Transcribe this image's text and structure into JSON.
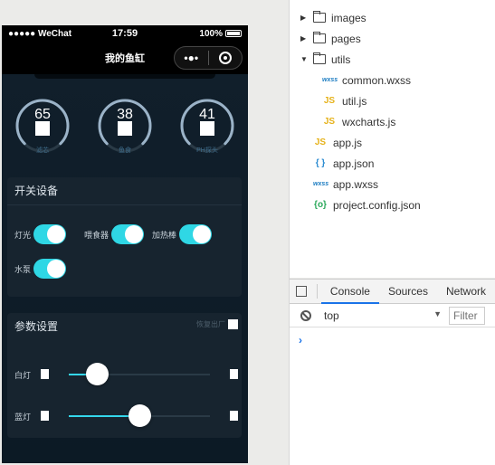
{
  "simulator": {
    "status": {
      "carrier": "●●●●● WeChat",
      "time": "17:59",
      "battery": "100%"
    },
    "nav": {
      "title": "我的鱼缸",
      "more": "•●•"
    },
    "gauges": [
      {
        "value": "65",
        "label": "滤芯",
        "fraction": 0.75
      },
      {
        "value": "38",
        "label": "鱼食",
        "fraction": 0.75
      },
      {
        "value": "41",
        "label": "PH探头",
        "fraction": 0.75
      }
    ],
    "switches": {
      "title": "开关设备",
      "items": [
        {
          "label": "灯光",
          "on": true
        },
        {
          "label": "喂食器",
          "on": true
        },
        {
          "label": "加热棒",
          "on": true
        },
        {
          "label": "水泵",
          "on": true
        }
      ]
    },
    "params": {
      "title": "参数设置",
      "reset": "恢复出厂",
      "sliders": [
        {
          "label": "白灯",
          "value": 0.2
        },
        {
          "label": "蓝灯",
          "value": 0.5
        }
      ]
    }
  },
  "explorer": {
    "items": [
      {
        "name": "images",
        "type": "folder",
        "expanded": false
      },
      {
        "name": "pages",
        "type": "folder",
        "expanded": false
      },
      {
        "name": "utils",
        "type": "folder",
        "expanded": true
      },
      {
        "name": "common.wxss",
        "type": "wxss"
      },
      {
        "name": "util.js",
        "type": "js"
      },
      {
        "name": "wxcharts.js",
        "type": "js"
      },
      {
        "name": "app.js",
        "type": "js"
      },
      {
        "name": "app.json",
        "type": "json"
      },
      {
        "name": "app.wxss",
        "type": "wxss"
      },
      {
        "name": "project.config.json",
        "type": "config"
      }
    ],
    "icons": {
      "wxss": "wxss",
      "js": "JS",
      "json": "{ }",
      "config": "{o}"
    }
  },
  "devtools": {
    "tabs": [
      "Console",
      "Sources",
      "Network"
    ],
    "active_tab": "Console",
    "context": "top",
    "filter_placeholder": "Filter",
    "prompt": "›",
    "accent": "#1a73e8"
  }
}
